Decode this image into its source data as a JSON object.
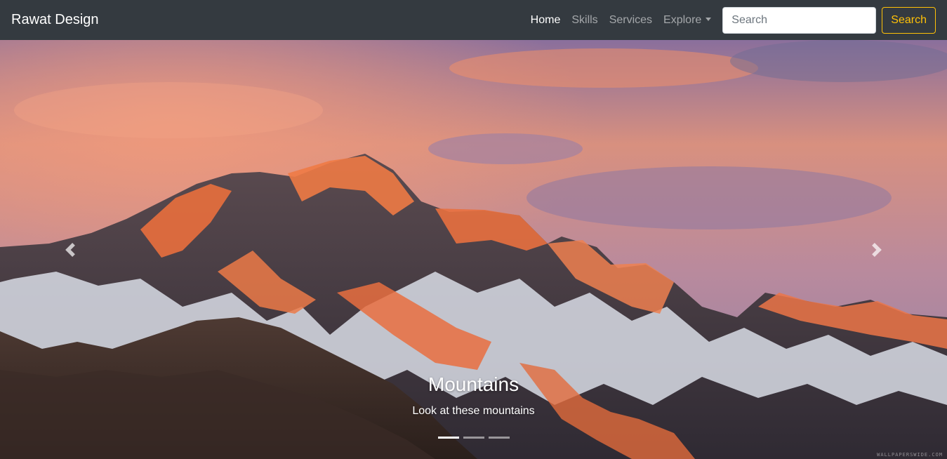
{
  "navbar": {
    "brand": "Rawat Design",
    "links": [
      {
        "label": "Home",
        "active": true
      },
      {
        "label": "Skills",
        "active": false
      },
      {
        "label": "Services",
        "active": false
      },
      {
        "label": "Explore",
        "active": false,
        "dropdown": true
      }
    ],
    "search": {
      "placeholder": "Search",
      "value": "",
      "button_label": "Search"
    },
    "colors": {
      "background": "#343a40",
      "search_button": "#ffc107"
    }
  },
  "carousel": {
    "caption_title": "Mountains",
    "caption_text": "Look at these mountains",
    "prev_icon": "chevron-left-icon",
    "next_icon": "chevron-right-icon",
    "slide_count": 3,
    "active_slide": 1,
    "watermark": "WALLPAPERSWIDE.COM"
  }
}
